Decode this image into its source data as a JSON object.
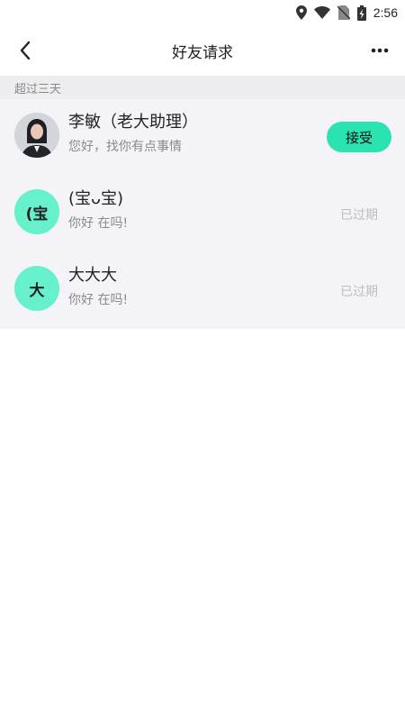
{
  "status_bar": {
    "time": "2:56",
    "icons": [
      "location-icon",
      "wifi-icon",
      "no-sim-icon",
      "battery-charging-icon"
    ]
  },
  "header": {
    "title": "好友请求",
    "back_icon": "back-arrow-icon",
    "more_icon": "more-dots-icon"
  },
  "section": {
    "label": "超过三天"
  },
  "requests": [
    {
      "name": "李敏（老大助理）",
      "message": "您好，找你有点事情",
      "avatar_type": "photo",
      "action": "接受",
      "status": ""
    },
    {
      "name": "(宝ᴗ宝)",
      "message": "你好 在吗!",
      "avatar_type": "text",
      "avatar_text": "(宝",
      "action": "",
      "status": "已过期"
    },
    {
      "name": "大大大",
      "message": "你好  在吗!",
      "avatar_type": "text",
      "avatar_text": "大",
      "action": "",
      "status": "已过期"
    }
  ],
  "colors": {
    "accent": "#2ae3b0",
    "avatar_bg": "#66f0cc",
    "list_bg": "#f4f4f8",
    "section_bg": "#ededef"
  }
}
